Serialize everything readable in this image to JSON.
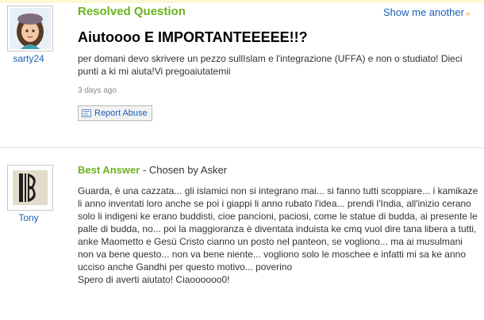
{
  "question": {
    "status": "Resolved Question",
    "show_more": "Show me another",
    "show_more_icon": "double-chevron-right",
    "title": "Aiutoooo E IMPORTANTEEEEE!!?",
    "body": "per domani devo skrivere un pezzo sullIslam e l'integrazione (UFFA) e non o studiato! Dieci punti a ki mi aiuta!Vi pregoaiutatemii",
    "time": "3 days ago",
    "report_label": "Report Abuse",
    "report_icon": "flag-icon",
    "asker": "sarty24"
  },
  "answer": {
    "label": "Best Answer",
    "chosen_by": " - Chosen by Asker",
    "answerer": "Tony",
    "body": "Guarda, è una cazzata... gli islamici non si integrano mai... si fanno tutti scoppiare... i kamikaze li anno inventati loro anche se poi i giappi li anno rubato l'idea... prendi l'India, all'inizio cerano solo li indigeni ke erano buddisti, cioe pancioni, paciosi, come le statue di budda, ai presente le palle di budda, no... poi la maggioranza è diventata induista ke cmq vuol dire tana libera a tutti, anke Maometto e Gesù Cristo cianno un posto nel panteon, se vogliono... ma ai musulmani non va bene questo... non va bene niente... vogliono solo le moschee e infatti mi sa ke anno ucciso anche Gandhi per questo motivo... poverino",
    "closing": "Spero di averti aiutato! Ciaoooooo0!"
  },
  "colors": {
    "accent_green": "#6bb31d",
    "link_blue": "#1a5fb4",
    "top_strip": "#fcf8d4"
  }
}
